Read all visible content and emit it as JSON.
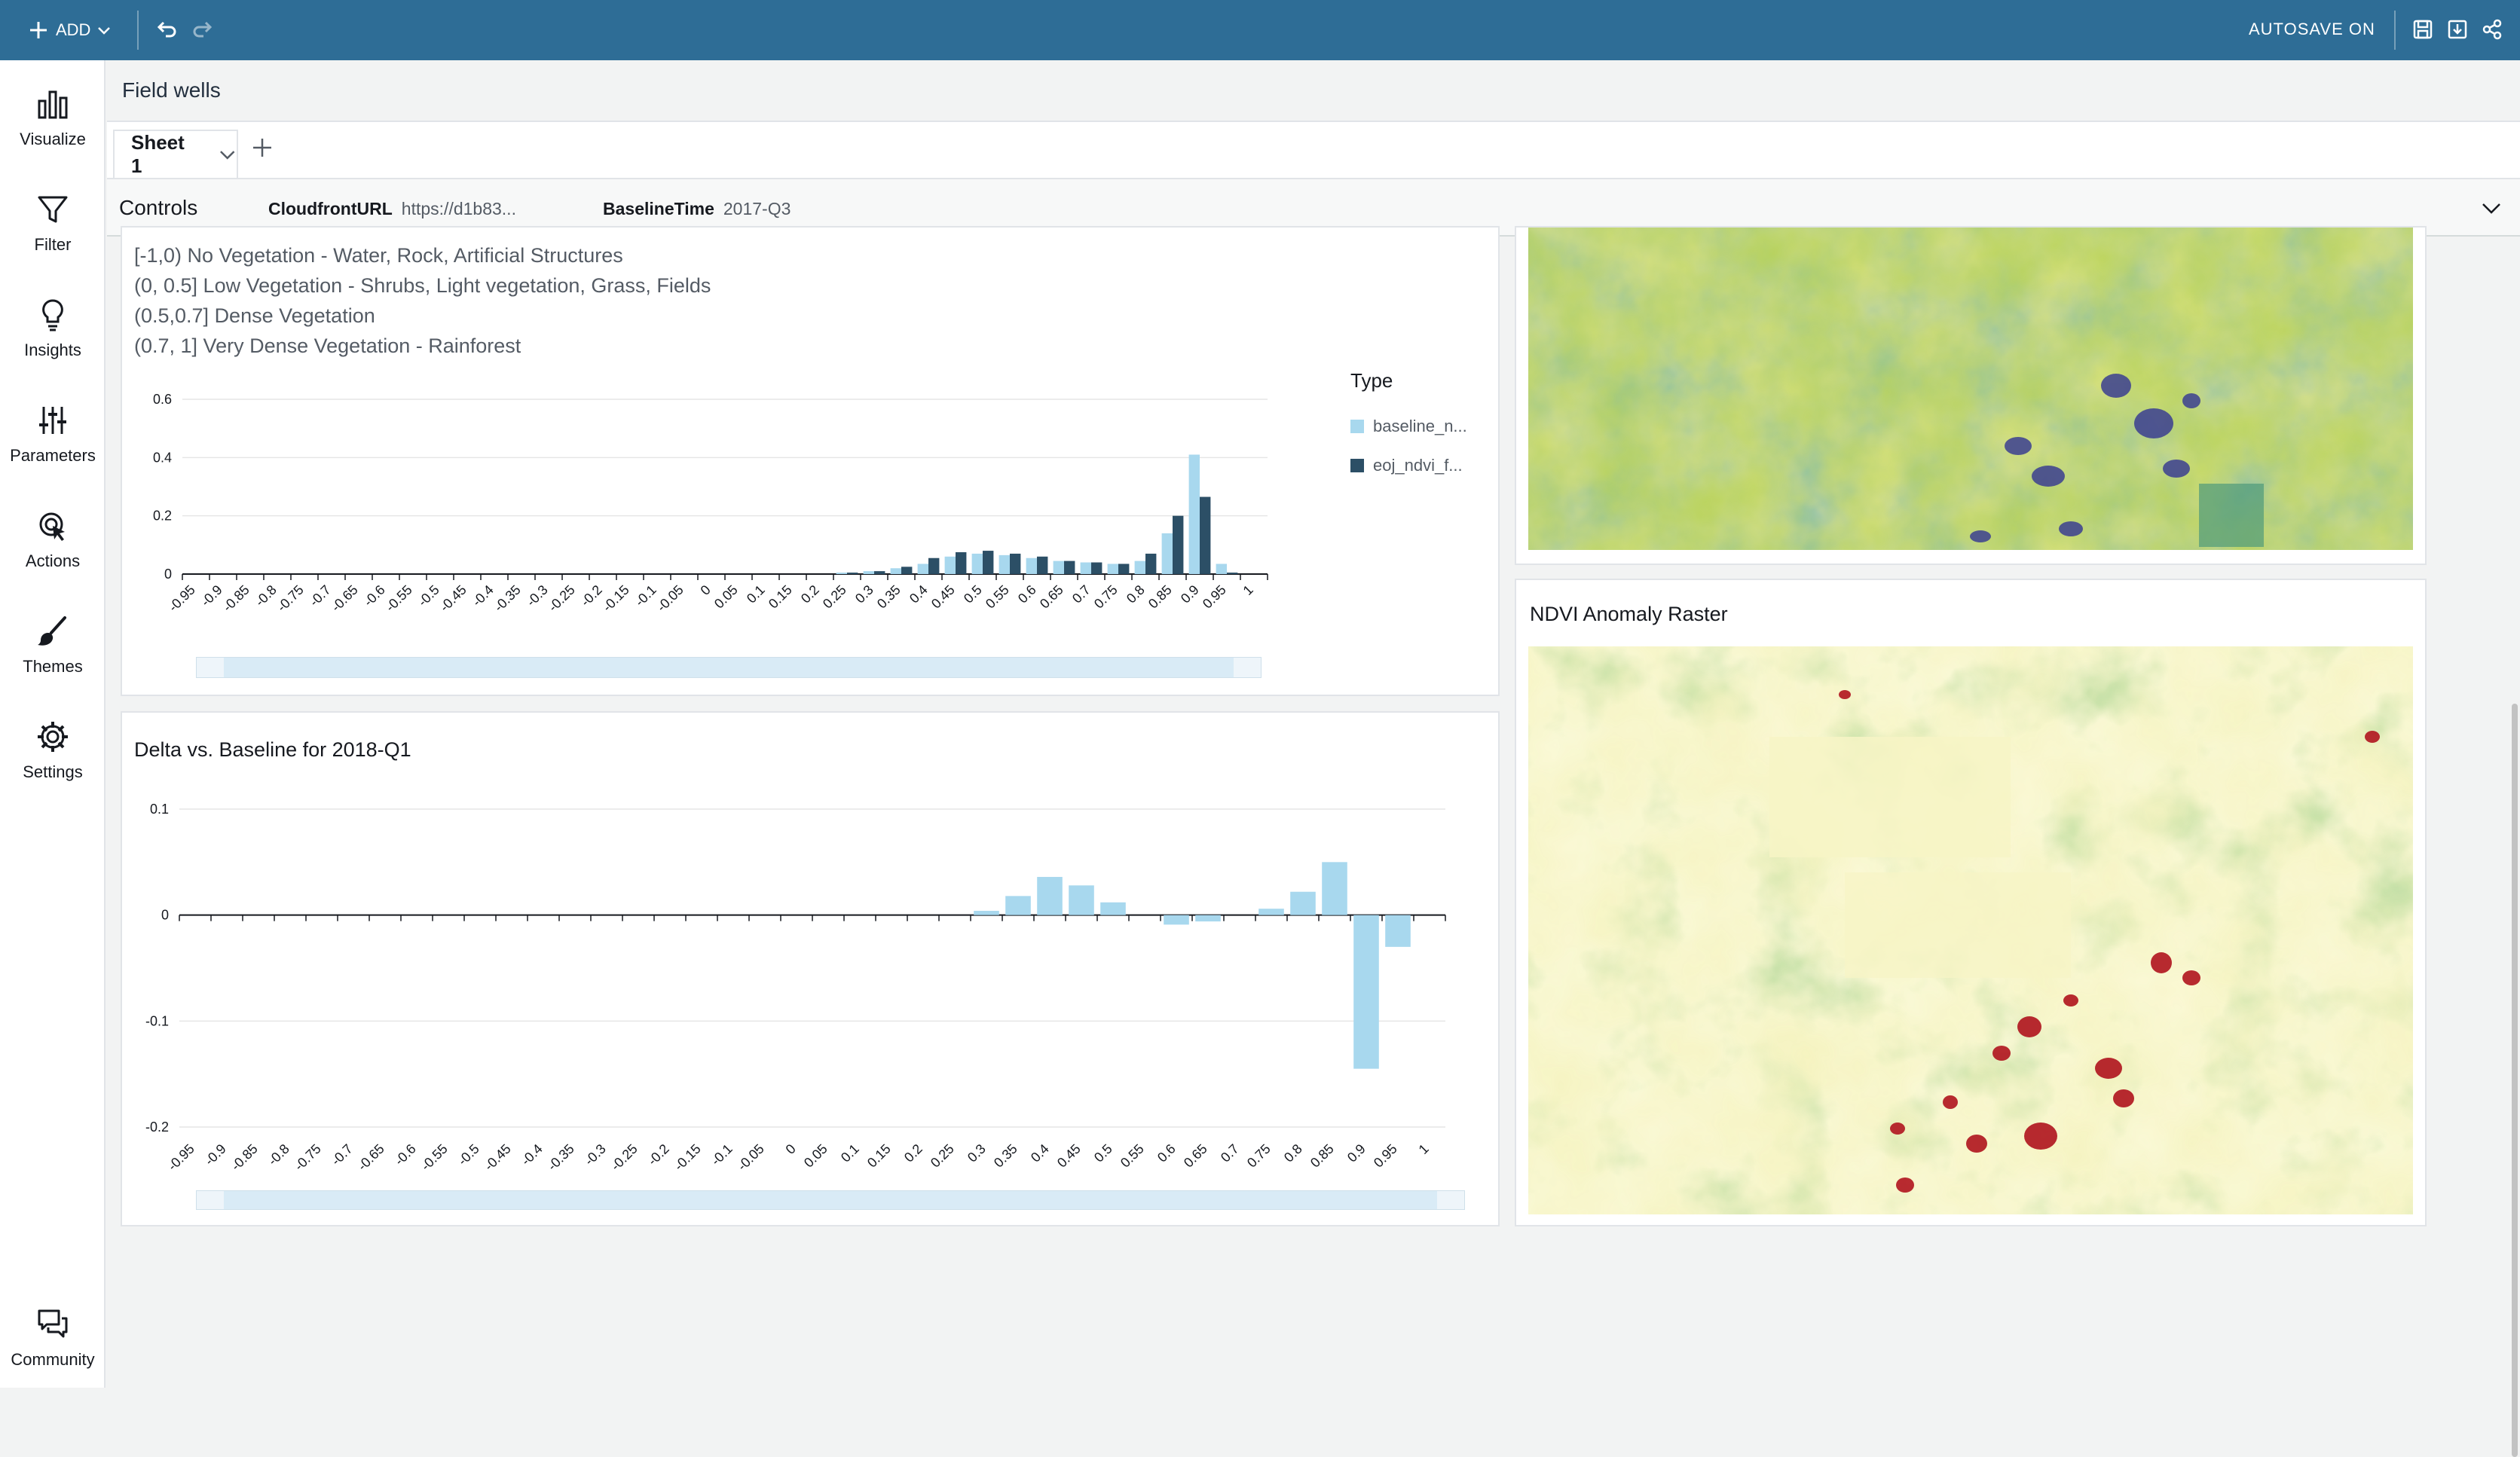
{
  "topbar": {
    "add_label": "ADD",
    "autosave_label": "AUTOSAVE ON",
    "background": "#2e6d96"
  },
  "nav": {
    "items": [
      {
        "label": "Visualize",
        "icon": "bar-chart-icon"
      },
      {
        "label": "Filter",
        "icon": "filter-icon"
      },
      {
        "label": "Insights",
        "icon": "lightbulb-icon"
      },
      {
        "label": "Parameters",
        "icon": "sliders-icon"
      },
      {
        "label": "Actions",
        "icon": "pointer-click-icon"
      },
      {
        "label": "Themes",
        "icon": "brush-icon"
      },
      {
        "label": "Settings",
        "icon": "gear-icon"
      },
      {
        "label": "Community",
        "icon": "chat-icon"
      }
    ]
  },
  "field_wells": {
    "label": "Field wells"
  },
  "sheets": {
    "tabs": [
      {
        "label": "Sheet 1"
      }
    ]
  },
  "controls": {
    "title": "Controls",
    "items": [
      {
        "name": "CloudfrontURL",
        "value": "https://d1b83..."
      },
      {
        "name": "BaselineTime",
        "value": "2017-Q3"
      }
    ]
  },
  "histogram_panel": {
    "legend_lines": [
      "[-1,0) No Vegetation - Water, Rock, Artificial Structures",
      "(0, 0.5] Low Vegetation - Shrubs, Light vegetation, Grass, Fields",
      "(0.5,0.7] Dense Vegetation",
      "(0.7, 1] Very Dense Vegetation - Rainforest"
    ]
  },
  "delta_panel": {
    "title": "Delta vs. Baseline for 2018-Q1"
  },
  "raster_panel": {
    "title": "NDVI Anomaly Raster"
  },
  "chart_data": [
    {
      "type": "bar",
      "categories": [
        "-0.95",
        "-0.9",
        "-0.85",
        "-0.8",
        "-0.75",
        "-0.7",
        "-0.65",
        "-0.6",
        "-0.55",
        "-0.5",
        "-0.45",
        "-0.4",
        "-0.35",
        "-0.3",
        "-0.25",
        "-0.2",
        "-0.15",
        "-0.1",
        "-0.05",
        "0",
        "0.05",
        "0.1",
        "0.15",
        "0.2",
        "0.25",
        "0.3",
        "0.35",
        "0.4",
        "0.45",
        "0.5",
        "0.55",
        "0.6",
        "0.65",
        "0.7",
        "0.75",
        "0.8",
        "0.85",
        "0.9",
        "0.95",
        "1"
      ],
      "series": [
        {
          "name": "baseline_n...",
          "color": "#a8d8ee",
          "values": [
            0,
            0,
            0,
            0,
            0,
            0,
            0,
            0,
            0,
            0,
            0,
            0,
            0,
            0,
            0,
            0,
            0,
            0,
            0,
            0,
            0,
            0,
            0,
            0,
            0.005,
            0.01,
            0.02,
            0.035,
            0.06,
            0.07,
            0.065,
            0.055,
            0.045,
            0.04,
            0.035,
            0.045,
            0.14,
            0.41,
            0.035,
            0
          ]
        },
        {
          "name": "eoj_ndvi_f...",
          "color": "#2c4f66",
          "values": [
            0,
            0,
            0,
            0,
            0,
            0,
            0,
            0,
            0,
            0,
            0,
            0,
            0,
            0,
            0,
            0,
            0,
            0,
            0,
            0,
            0,
            0,
            0,
            0,
            0.005,
            0.01,
            0.025,
            0.055,
            0.075,
            0.08,
            0.07,
            0.06,
            0.045,
            0.04,
            0.035,
            0.07,
            0.2,
            0.265,
            0.005,
            0
          ]
        }
      ],
      "legend_title": "Type",
      "ylim": [
        0,
        0.6
      ],
      "yticks": [
        "0",
        "0.2",
        "0.4",
        "0.6"
      ],
      "legend": "right"
    },
    {
      "type": "bar",
      "title": "Delta vs. Baseline for 2018-Q1",
      "categories": [
        "-0.95",
        "-0.9",
        "-0.85",
        "-0.8",
        "-0.75",
        "-0.7",
        "-0.65",
        "-0.6",
        "-0.55",
        "-0.5",
        "-0.45",
        "-0.4",
        "-0.35",
        "-0.3",
        "-0.25",
        "-0.2",
        "-0.15",
        "-0.1",
        "-0.05",
        "0",
        "0.05",
        "0.1",
        "0.15",
        "0.2",
        "0.25",
        "0.3",
        "0.35",
        "0.4",
        "0.45",
        "0.5",
        "0.55",
        "0.6",
        "0.65",
        "0.7",
        "0.75",
        "0.8",
        "0.85",
        "0.9",
        "0.95",
        "1"
      ],
      "values": [
        0,
        0,
        0,
        0,
        0,
        0,
        0,
        0,
        0,
        0,
        0,
        0,
        0,
        0,
        0,
        0,
        0,
        0,
        0,
        0,
        0,
        0,
        0,
        0,
        0,
        0.004,
        0.018,
        0.036,
        0.028,
        0.012,
        0,
        -0.009,
        -0.006,
        0,
        0.006,
        0.022,
        0.05,
        -0.145,
        -0.03,
        0
      ],
      "color": "#a8d8ee",
      "ylim": [
        -0.2,
        0.1
      ],
      "yticks": [
        "0.1",
        "0",
        "-0.1",
        "-0.2"
      ]
    }
  ]
}
